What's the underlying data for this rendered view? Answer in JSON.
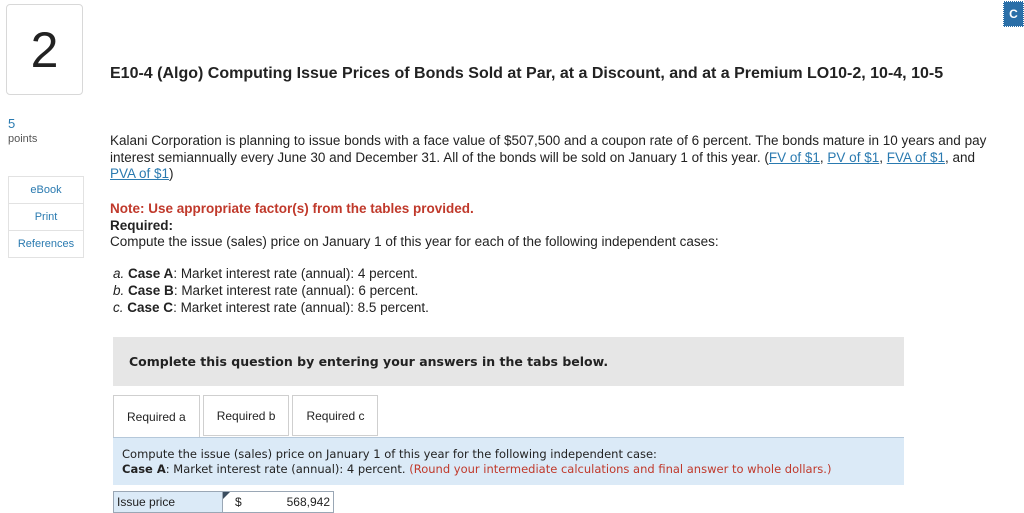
{
  "question": {
    "number": "2",
    "points_value": "5",
    "points_label": "points"
  },
  "side_links": [
    "eBook",
    "Print",
    "References"
  ],
  "title": "E10-4 (Algo) Computing Issue Prices of Bonds Sold at Par, at a Discount, and at a Premium LO10-2, 10-4, 10-5",
  "intro": {
    "text": "Kalani Corporation is planning to issue bonds with a face value of $507,500 and a coupon rate of 6 percent. The bonds mature in 10 years and pay interest semiannually every June 30 and December 31. All of the bonds will be sold on January 1 of this year. (",
    "links": [
      "FV of $1",
      "PV of $1",
      "FVA of $1",
      "PVA of $1"
    ],
    "sep1": ", ",
    "sep2": ", ",
    "sep3": ", and ",
    "close": ")"
  },
  "note": "Note: Use appropriate factor(s) from the tables provided.",
  "required_label": "Required:",
  "required_text": "Compute the issue (sales) price on January 1 of this year for each of the following independent cases:",
  "cases": [
    {
      "letter": "a.",
      "name": "Case A",
      "text": ": Market interest rate (annual): 4 percent."
    },
    {
      "letter": "b.",
      "name": "Case B",
      "text": ": Market interest rate (annual): 6 percent."
    },
    {
      "letter": "c.",
      "name": "Case C",
      "text": ": Market interest rate (annual): 8.5 percent."
    }
  ],
  "banner": "Complete this question by entering your answers in the tabs below.",
  "tabs": [
    "Required a",
    "Required b",
    "Required c"
  ],
  "active_tab": 0,
  "panel": {
    "line1": "Compute the issue (sales) price on January 1 of this year for the following independent case:",
    "case_name": "Case A",
    "line2": ": Market interest rate (annual): 4 percent.",
    "instruction": "(Round your intermediate calculations and final answer to whole dollars.)"
  },
  "answer": {
    "label": "Issue price",
    "currency": "$",
    "value": "568,942"
  },
  "corner_button": "C"
}
